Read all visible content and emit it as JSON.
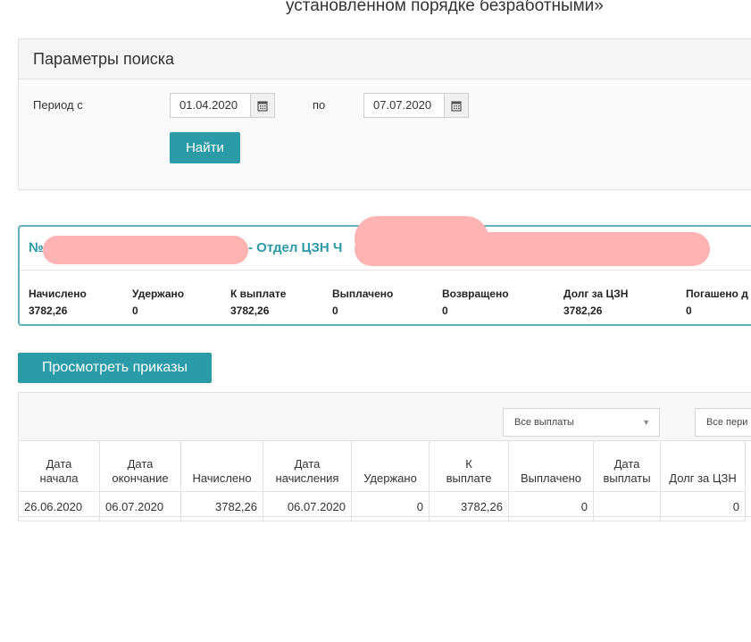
{
  "header": {
    "title_fragment": "установленном порядке безработными»"
  },
  "search": {
    "heading": "Параметры поиска",
    "period_from_label": "Период с",
    "date_from": "01.04.2020",
    "to_label": "по",
    "date_to": "07.07.2020",
    "find_button": "Найти"
  },
  "summary": {
    "title_prefix": "№",
    "title_middle": "- Отдел ЦЗН Ч",
    "stats": [
      {
        "label": "Начислено",
        "value": "3782,26"
      },
      {
        "label": "Удержано",
        "value": "0"
      },
      {
        "label": "К выплате",
        "value": "3782,26"
      },
      {
        "label": "Выплачено",
        "value": "0"
      },
      {
        "label": "Возвращено",
        "value": "0"
      },
      {
        "label": "Долг за ЦЗН",
        "value": "3782,26"
      },
      {
        "label": "Погашено д",
        "value": "0"
      }
    ],
    "redaction_color": "#ffb3b3"
  },
  "orders_button": "Просмотреть приказы",
  "filters": {
    "payments_select": "Все выплаты",
    "periods_select": "Все пери"
  },
  "table": {
    "headers": [
      "Дата начала",
      "Дата окончание",
      "Начислено",
      "Дата начисления",
      "Удержано",
      "К выплате",
      "Выплачено",
      "Дата выплаты",
      "Долг за ЦЗН"
    ],
    "rows": [
      [
        "26.06.2020",
        "06.07.2020",
        "3782,26",
        "06.07.2020",
        "0",
        "3782,26",
        "0",
        "",
        "0"
      ]
    ]
  },
  "colors": {
    "accent": "#2a9ba7",
    "card_border": "#5fb2bb"
  }
}
